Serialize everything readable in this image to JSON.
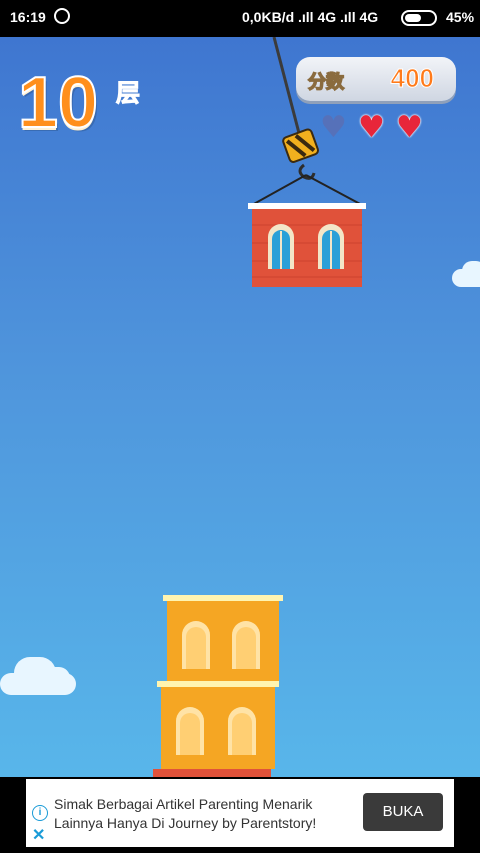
{
  "status_bar": {
    "time": "16:19",
    "network": "0,0KB/d .ıll 4G .ıll 4G",
    "battery_percent": "45%"
  },
  "game": {
    "floor_number": "10",
    "floor_unit": "层",
    "score_label": "分数",
    "score_value": "400",
    "lives_total": 3,
    "lives_remaining": 2,
    "colors": {
      "accent_orange": "#ff8f1c",
      "hook_block_brick": "#e0523a",
      "tower_block": "#f5a623",
      "heart": "#e8263a"
    }
  },
  "ad": {
    "line1": "Simak Berbagai Artikel Parenting Menarik",
    "line2": "Lainnya Hanya Di Journey by Parentstory!",
    "button": "BUKA",
    "info_icon": "info-icon",
    "close_icon": "close-icon"
  }
}
